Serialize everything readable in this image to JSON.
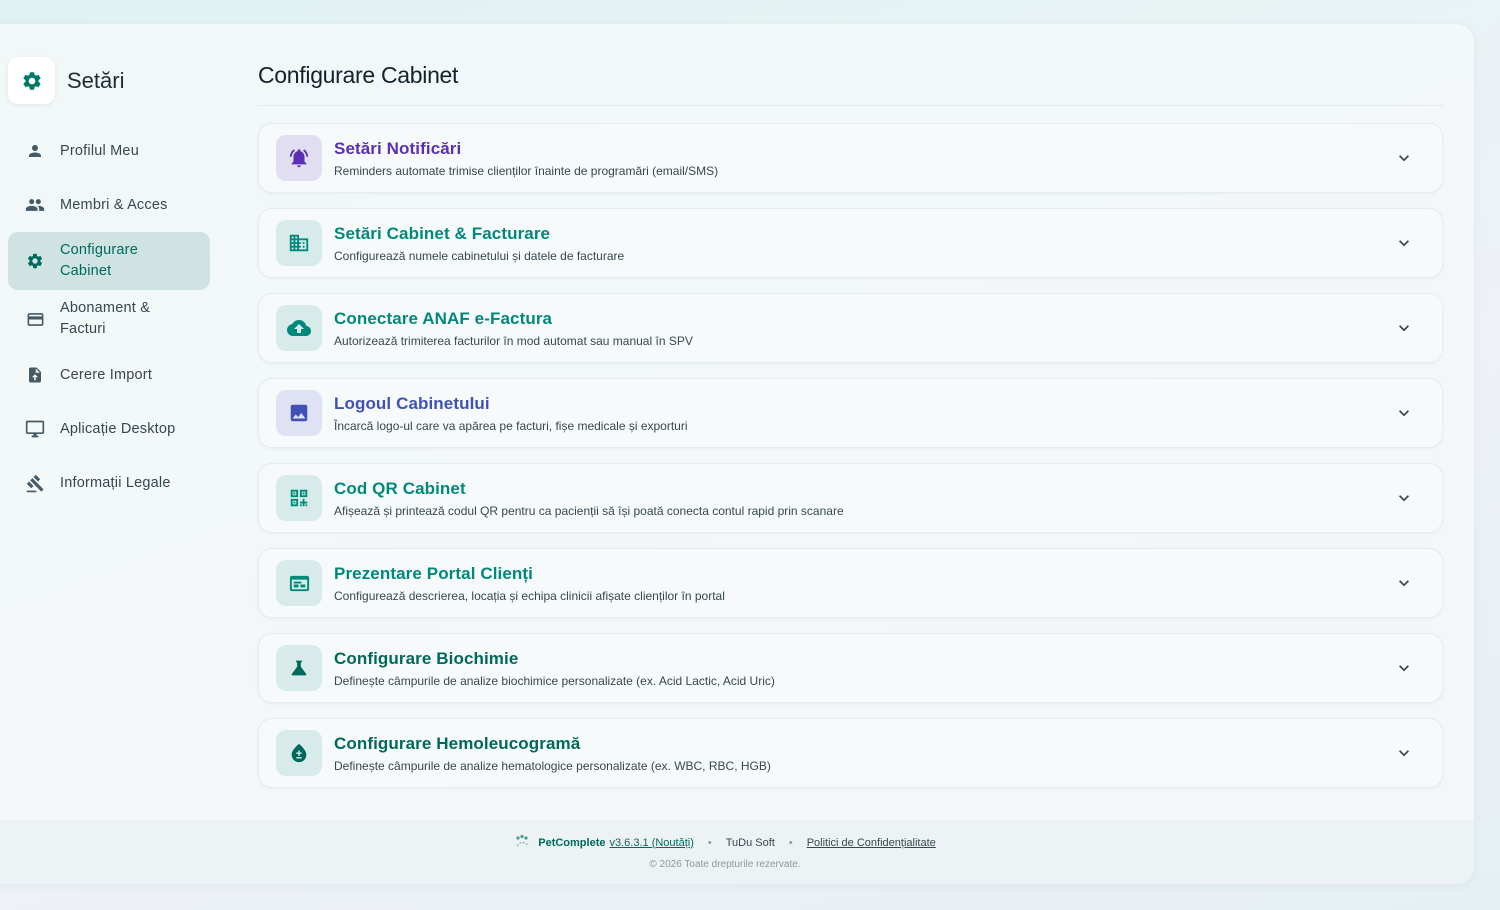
{
  "sidebar": {
    "title": "Setări",
    "items": [
      {
        "label": "Profilul Meu",
        "icon": "person-icon"
      },
      {
        "label": "Membri & Acces",
        "icon": "group-icon"
      },
      {
        "label": "Configurare Cabinet",
        "icon": "settings-gear-icon",
        "active": true
      },
      {
        "label": "Abonament & Facturi",
        "icon": "credit-card-icon"
      },
      {
        "label": "Cerere Import",
        "icon": "file-upload-icon"
      },
      {
        "label": "Aplicație Desktop",
        "icon": "monitor-icon"
      },
      {
        "label": "Informații Legale",
        "icon": "gavel-icon"
      }
    ]
  },
  "main": {
    "title": "Configurare Cabinet",
    "sections": [
      {
        "title": "Setări Notificări",
        "description": "Reminders automate trimise clienților înainte de programări (email/SMS)",
        "icon": "notification-bell-icon",
        "color": "#5b2fb5",
        "icon_bg": "#e2def2"
      },
      {
        "title": "Setări Cabinet & Facturare",
        "description": "Configurează numele cabinetului și datele de facturare",
        "icon": "building-icon",
        "color": "#00897b",
        "icon_bg": "#d7ecea"
      },
      {
        "title": "Conectare ANAF e-Factura",
        "description": "Autorizează trimiterea facturilor în mod automat sau manual în SPV",
        "icon": "cloud-upload-icon",
        "color": "#00897b",
        "icon_bg": "#d7ecea"
      },
      {
        "title": "Logoul Cabinetului",
        "description": "Încarcă logo-ul care va apărea pe facturi, fișe medicale și exporturi",
        "icon": "image-icon",
        "color": "#3f51b5",
        "icon_bg": "#dfe2f2"
      },
      {
        "title": "Cod QR Cabinet",
        "description": "Afișează și printează codul QR pentru ca pacienții să își poată conecta contul rapid prin scanare",
        "icon": "qr-code-icon",
        "color": "#00897b",
        "icon_bg": "#d7ecea"
      },
      {
        "title": "Prezentare Portal Clienți",
        "description": "Configurează descrierea, locația și echipa clinicii afișate clienților în portal",
        "icon": "web-portal-icon",
        "color": "#00897b",
        "icon_bg": "#d7ecea"
      },
      {
        "title": "Configurare Biochimie",
        "description": "Definește câmpurile de analize biochimice personalizate (ex. Acid Lactic, Acid Uric)",
        "icon": "flask-icon",
        "color": "#00695c",
        "icon_bg": "#d7ecea"
      },
      {
        "title": "Configurare Hemoleucogramă",
        "description": "Definește câmpurile de analize hematologice personalizate (ex. WBC, RBC, HGB)",
        "icon": "blood-drop-icon",
        "color": "#00695c",
        "icon_bg": "#d7ecea"
      }
    ]
  },
  "footer": {
    "brand": "PetComplete",
    "version": "v3.6.3.1 (Noutăți)",
    "separator": "•",
    "company": "TuDu Soft",
    "policy": "Politici de Confidențialitate",
    "copyright": "© 2026 Toate drepturile rezervate."
  }
}
